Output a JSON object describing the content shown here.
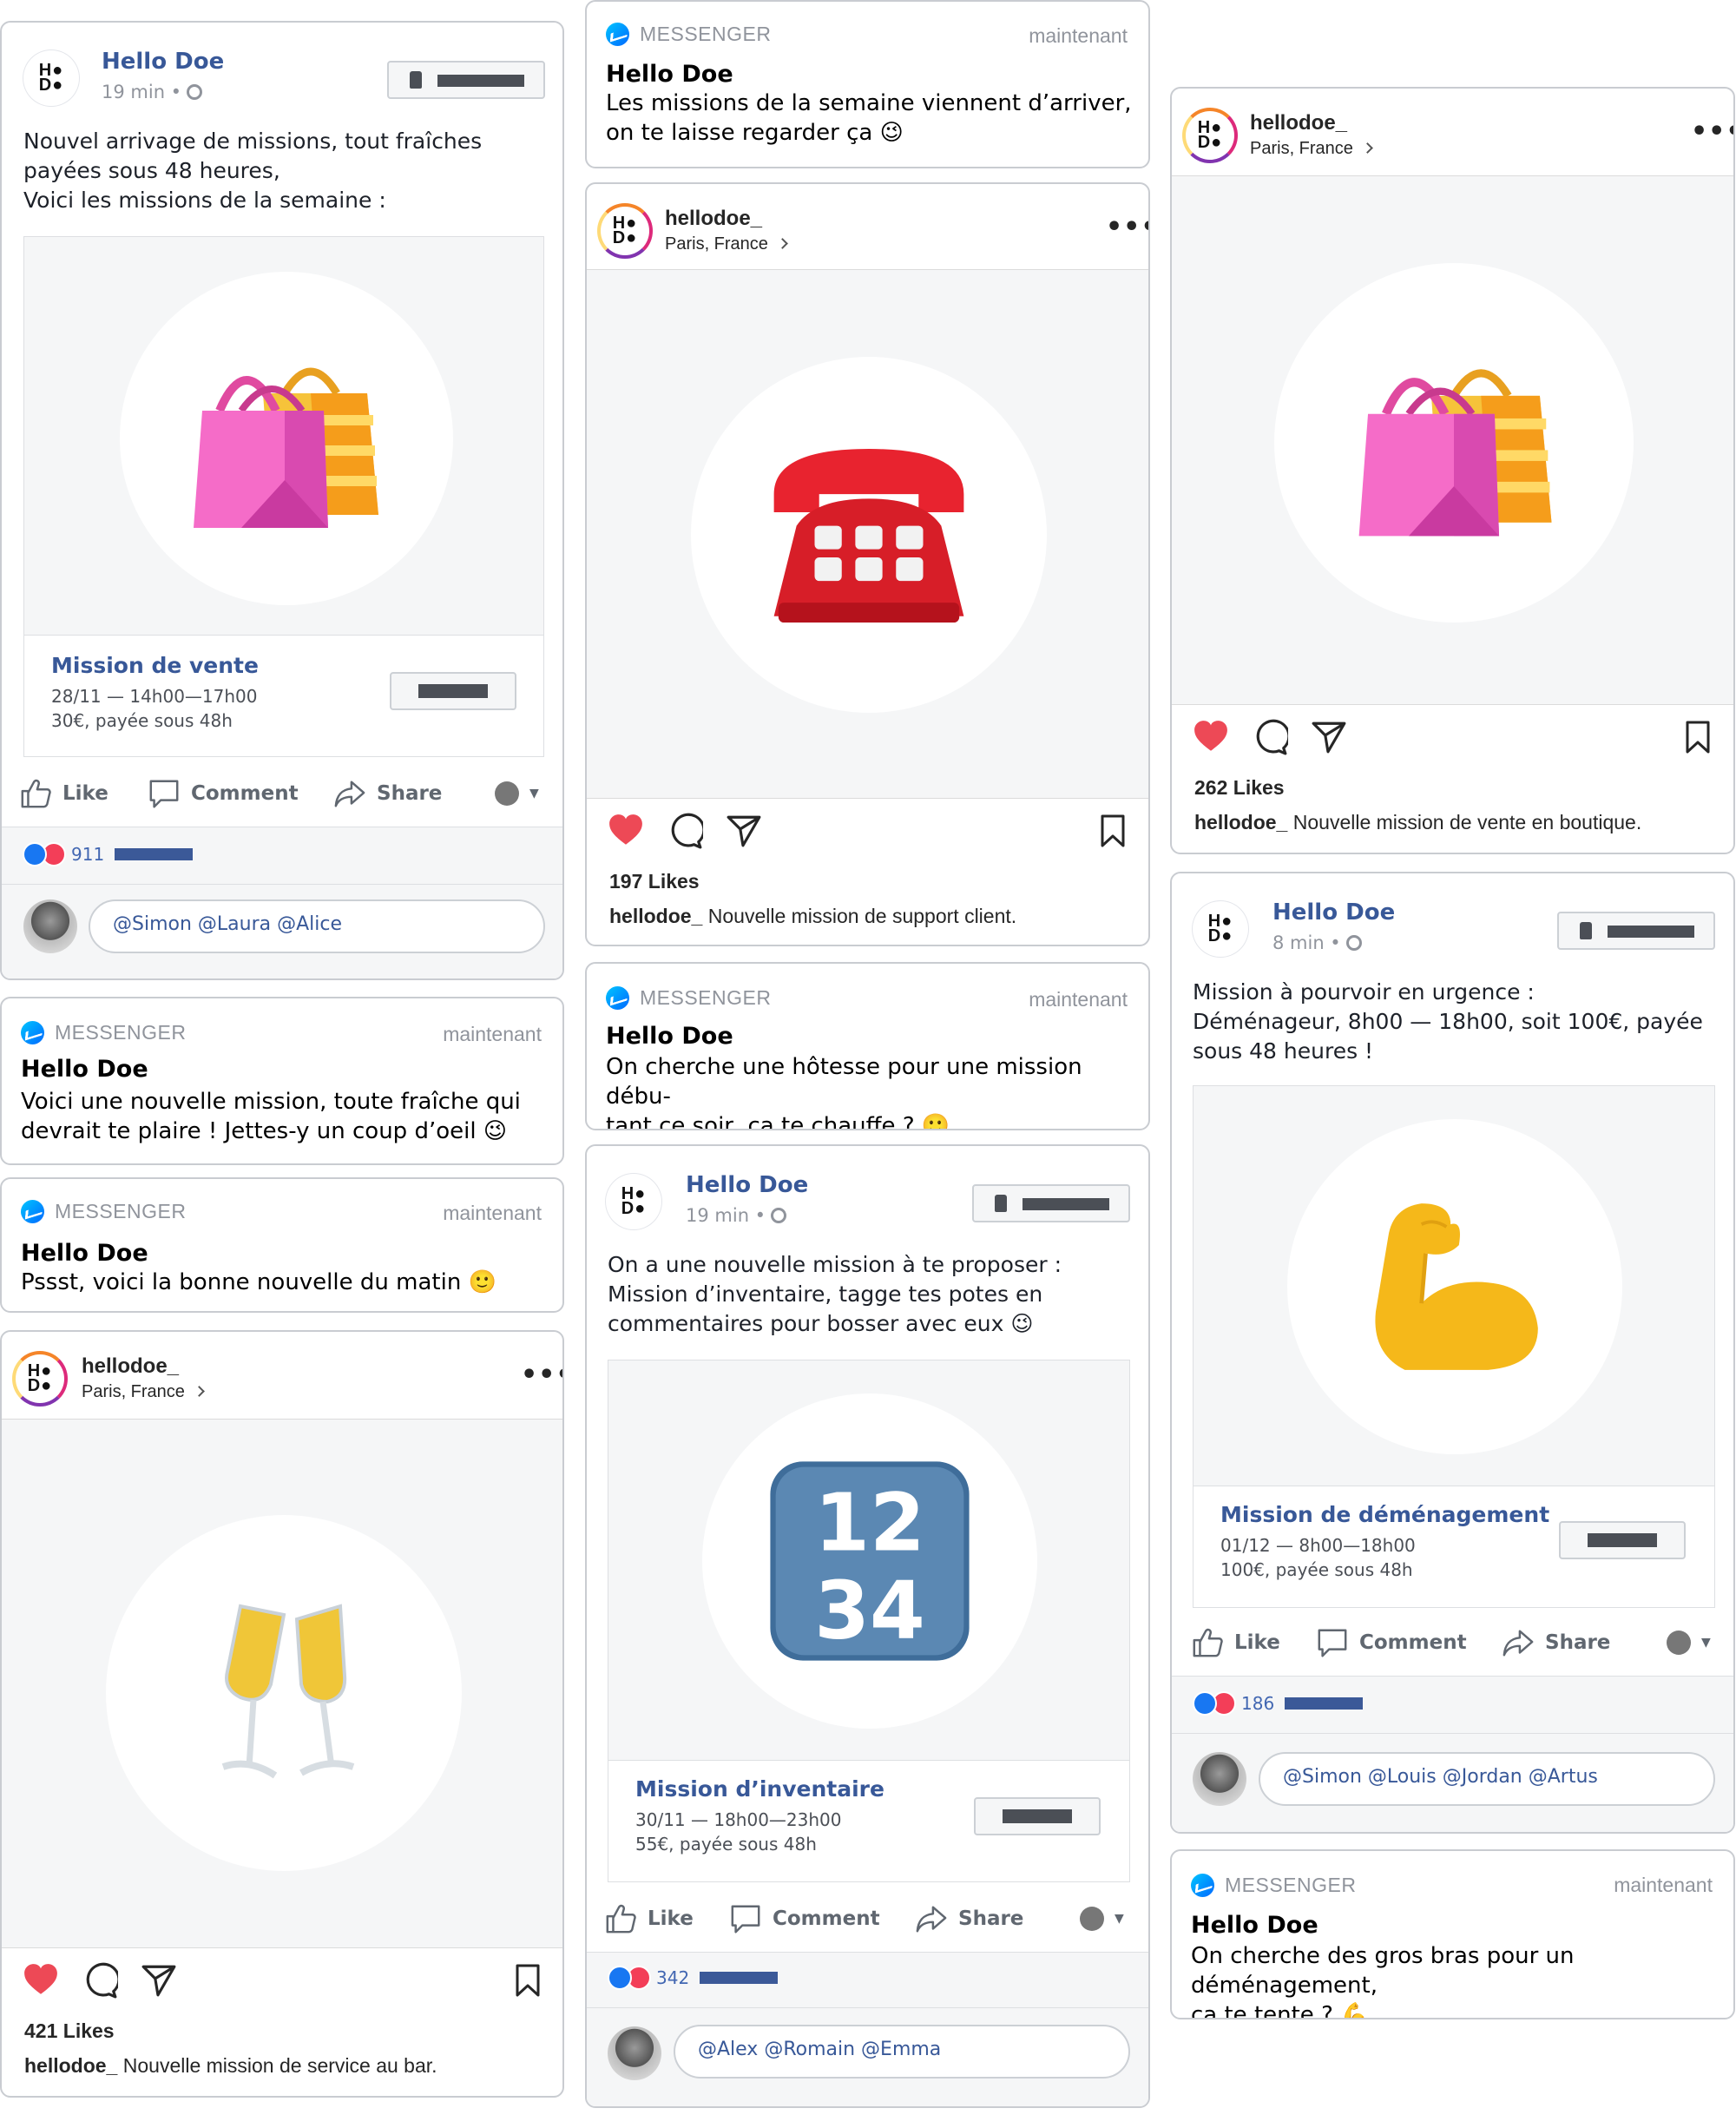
{
  "brand": {
    "logo_text": "H●\nD●",
    "fb_name": "Hello Doe",
    "ig_user": "hellodoe_",
    "ig_location": "Paris, France",
    "fb_blue": "#385898",
    "heart_red": "#ed4956"
  },
  "common": {
    "like": "Like",
    "comment": "Comment",
    "share": "Share",
    "messenger": "MESSENGER",
    "now": "maintenant",
    "globe_icon": "globe-icon"
  },
  "fb_posts": [
    {
      "time": "19 min •",
      "text": "Nouvel arrivage de missions, tout fraîches\npayées sous 48 heures,\nVoici les missions de la semaine :",
      "emoji": "shopping-bags-icon",
      "title": "Mission de vente",
      "line1": "28/11 — 14h00—17h00",
      "line2": "30€, payée sous 48h",
      "count": "911",
      "tags": "@Simon @Laura @Alice"
    },
    {
      "time": "19 min •",
      "text": "On a une nouvelle mission à te proposer :\nMission d’inventaire, tagge tes potes en\ncommentaires pour bosser avec eux 😉",
      "emoji": "input-numbers-icon",
      "title": "Mission d’inventaire",
      "line1": "30/11 — 18h00—23h00",
      "line2": "55€, payée sous 48h",
      "count": "342",
      "tags": "@Alex @Romain @Emma"
    },
    {
      "time": "8 min •",
      "text": "Mission à pourvoir en urgence :\nDéménageur, 8h00 — 18h00, soit 100€, payée\nsous 48 heures !",
      "emoji": "flexed-biceps-icon",
      "title": "Mission de déménagement",
      "line1": "01/12 — 8h00—18h00",
      "line2": "100€, payée sous 48h",
      "count": "186",
      "tags": "@Simon @Louis @Jordan @Artus"
    }
  ],
  "messages": [
    {
      "name": "Hello Doe",
      "text": "Les missions de la semaine viennent d’arriver,\non te laisse regarder ça 😉"
    },
    {
      "name": "Hello Doe",
      "text": "Voici une nouvelle mission, toute fraîche qui\ndevrait te plaire ! Jettes-y un coup d’oeil 😉"
    },
    {
      "name": "Hello Doe",
      "text": "Pssst, voici la bonne nouvelle du matin 🙂"
    },
    {
      "name": "Hello Doe",
      "text": "On cherche une hôtesse pour une mission débu-\ntant ce soir, ça te chauffe ? 🙂"
    },
    {
      "name": "Hello Doe",
      "text": "On cherche des gros bras pour un déménagement,\nça te tente ? 💪"
    }
  ],
  "ig_posts": [
    {
      "emoji": "telephone-icon",
      "likes": "197 Likes",
      "caption": "Nouvelle mission de support client."
    },
    {
      "emoji": "shopping-bags-icon",
      "likes": "262 Likes",
      "caption": "Nouvelle mission de vente en boutique."
    },
    {
      "emoji": "clinking-glasses-icon",
      "likes": "421 Likes",
      "caption": "Nouvelle mission de service au bar."
    }
  ]
}
